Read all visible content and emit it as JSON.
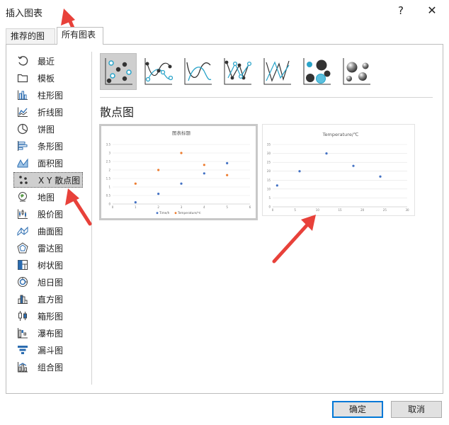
{
  "window": {
    "title": "插入图表",
    "help_label": "?",
    "close_label": "✕"
  },
  "tabs": [
    {
      "label": "推荐的图表",
      "active": false
    },
    {
      "label": "所有图表",
      "active": true
    }
  ],
  "sidebar": {
    "items": [
      {
        "label": "最近",
        "icon": "recent-icon"
      },
      {
        "label": "模板",
        "icon": "template-folder-icon"
      },
      {
        "label": "柱形图",
        "icon": "column-chart-icon"
      },
      {
        "label": "折线图",
        "icon": "line-chart-icon"
      },
      {
        "label": "饼图",
        "icon": "pie-chart-icon"
      },
      {
        "label": "条形图",
        "icon": "bar-chart-icon"
      },
      {
        "label": "面积图",
        "icon": "area-chart-icon"
      },
      {
        "label": "X Y 散点图",
        "icon": "scatter-chart-icon",
        "selected": true
      },
      {
        "label": "地图",
        "icon": "map-chart-icon"
      },
      {
        "label": "股价图",
        "icon": "stock-chart-icon"
      },
      {
        "label": "曲面图",
        "icon": "surface-chart-icon"
      },
      {
        "label": "雷达图",
        "icon": "radar-chart-icon"
      },
      {
        "label": "树状图",
        "icon": "treemap-chart-icon"
      },
      {
        "label": "旭日图",
        "icon": "sunburst-chart-icon"
      },
      {
        "label": "直方图",
        "icon": "histogram-chart-icon"
      },
      {
        "label": "箱形图",
        "icon": "box-whisker-chart-icon"
      },
      {
        "label": "瀑布图",
        "icon": "waterfall-chart-icon"
      },
      {
        "label": "漏斗图",
        "icon": "funnel-chart-icon"
      },
      {
        "label": "组合图",
        "icon": "combo-chart-icon"
      }
    ]
  },
  "subtypes": [
    {
      "icon": "scatter-icon",
      "selected": true
    },
    {
      "icon": "scatter-smooth-lines-markers-icon"
    },
    {
      "icon": "scatter-smooth-lines-icon"
    },
    {
      "icon": "scatter-straight-lines-markers-icon"
    },
    {
      "icon": "scatter-straight-lines-icon"
    },
    {
      "icon": "bubble-icon"
    },
    {
      "icon": "bubble-3d-icon"
    }
  ],
  "section_heading": "散点图",
  "chart_data": [
    {
      "type": "scatter",
      "title": "图表标题",
      "xlim": [
        0,
        6
      ],
      "ylim": [
        0,
        3.5
      ],
      "x_ticks": [
        "0",
        "1",
        "2",
        "3",
        "4",
        "5",
        "6"
      ],
      "y_ticks": [
        "0",
        "0.5",
        "1",
        "1.5",
        "2",
        "2.5",
        "3",
        "3.5"
      ],
      "grid": true,
      "legend": "bottom",
      "series": [
        {
          "name": "Time/h",
          "color": "#4472c4",
          "x": [
            1,
            2,
            3,
            4,
            5
          ],
          "y": [
            0.1,
            0.6,
            1.2,
            1.8,
            2.4
          ]
        },
        {
          "name": "Temperature/℃",
          "color": "#ed7d31",
          "x": [
            1,
            2,
            3,
            4,
            5
          ],
          "y": [
            1.2,
            2.0,
            3.0,
            2.3,
            1.7
          ]
        }
      ]
    },
    {
      "type": "scatter",
      "title": "Temperature/℃",
      "xlim": [
        0,
        30
      ],
      "ylim": [
        0,
        35
      ],
      "x_ticks": [
        "0",
        "5",
        "10",
        "15",
        "20",
        "25",
        "30"
      ],
      "y_ticks": [
        "0",
        "5",
        "10",
        "15",
        "20",
        "25",
        "30",
        "35"
      ],
      "grid": true,
      "legend": "none",
      "series": [
        {
          "color": "#4472c4",
          "x": [
            1,
            6,
            12,
            18,
            24
          ],
          "y": [
            12,
            20,
            30,
            23,
            17
          ]
        }
      ]
    }
  ],
  "footer": {
    "ok_label": "确定",
    "cancel_label": "取消"
  },
  "annotation_color": "#e8413a"
}
